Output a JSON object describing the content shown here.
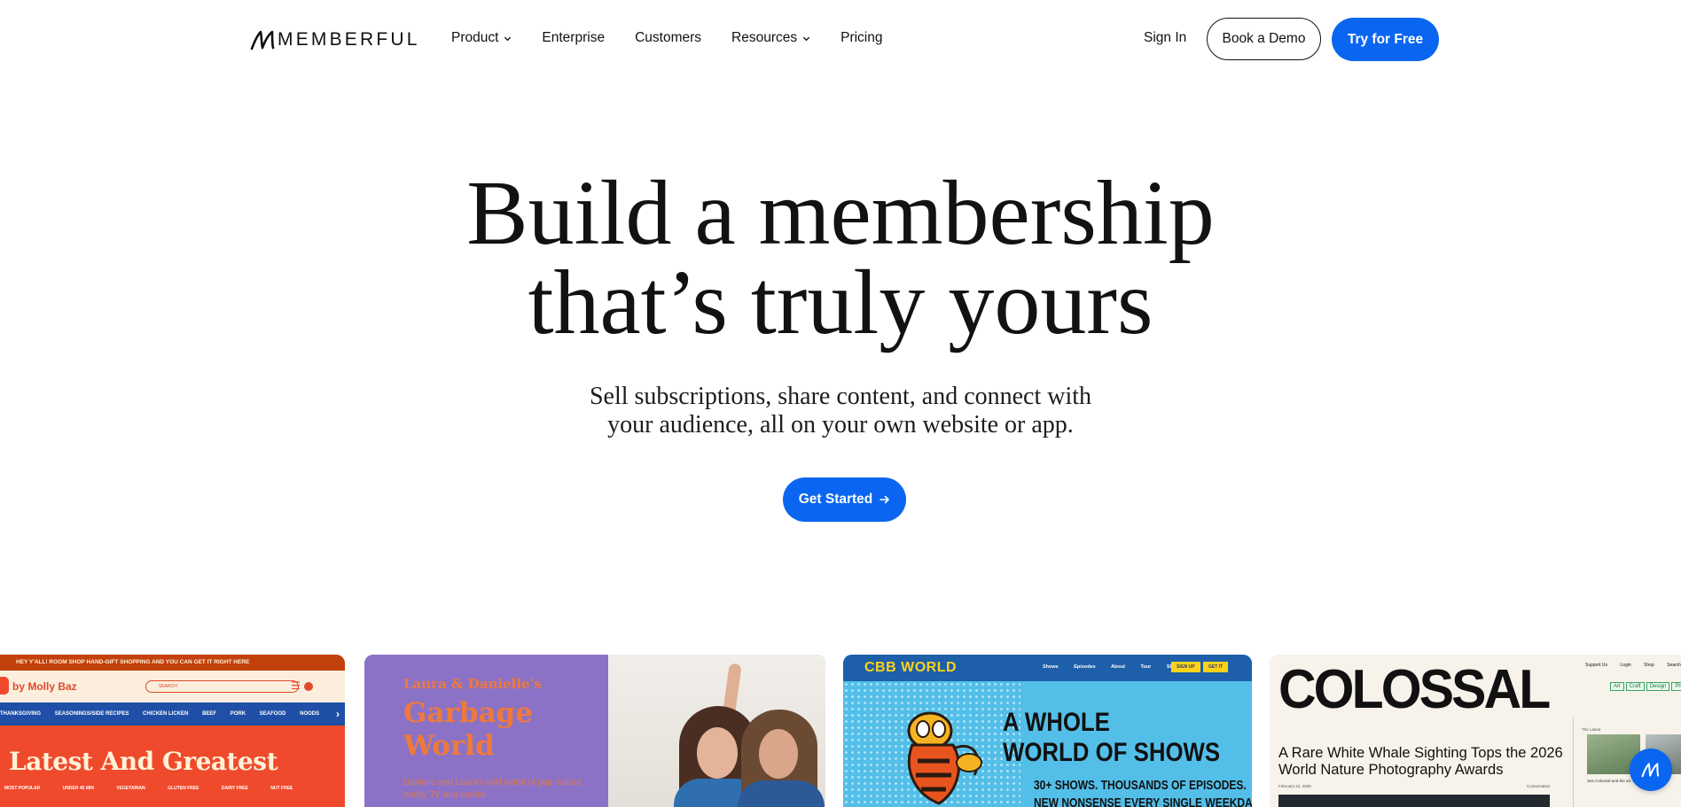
{
  "header": {
    "logo_text": "MEMBERFUL",
    "nav": [
      {
        "label": "Product",
        "has_dropdown": true
      },
      {
        "label": "Enterprise",
        "has_dropdown": false
      },
      {
        "label": "Customers",
        "has_dropdown": false
      },
      {
        "label": "Resources",
        "has_dropdown": true
      },
      {
        "label": "Pricing",
        "has_dropdown": false
      }
    ],
    "sign_in": "Sign In",
    "book_demo": "Book a Demo",
    "try_free": "Try for Free"
  },
  "hero": {
    "title_line1": "Build a membership",
    "title_line2": "that’s truly yours",
    "subtitle_line1": "Sell subscriptions, share content, and connect with",
    "subtitle_line2": "your audience, all on your own website or app.",
    "cta": "Get Started"
  },
  "showcase": {
    "card1": {
      "topbar": "HEY Y'ALL! ROOM SHOP HAND-GIFT SHOPPING AND YOU CAN GET IT RIGHT HERE",
      "byline": "by Molly Baz",
      "search_placeholder": "SEARCH",
      "strip": [
        "THANKSGIVING",
        "SEASONINGS/SIDE RECIPES",
        "CHICKEN LICKEN",
        "BEEF",
        "PORK",
        "SEAFOOD",
        "NOODS"
      ],
      "headline": "Latest And Greatest",
      "categories": [
        "MOST POPULAR",
        "UNDER 45 MIN",
        "VEGETARIAN",
        "GLUTEN FREE",
        "DAIRY FREE",
        "NUT FREE"
      ]
    },
    "card2": {
      "kicker": "Laura & Danielle's",
      "title_line1": "Garbage",
      "title_line2": "World",
      "desc": "Danielle and Laura's wild world of pop culture, reality TV and stories"
    },
    "card3": {
      "brand": "CBB WORLD",
      "links": [
        "Shows",
        "Episodes",
        "About",
        "Tour",
        "Shop"
      ],
      "pill1": "SIGN UP",
      "pill2": "GET IT",
      "headline_line1": "A WHOLE",
      "headline_line2": "WORLD OF SHOWS",
      "sub_line1": "30+ SHOWS. THOUSANDS OF EPISODES.",
      "sub_line2": "NEW NONSENSE EVERY SINGLE WEEKDAY"
    },
    "card4": {
      "logo": "COLOSSAL",
      "toplinks": [
        "Support Us",
        "Login",
        "Shop",
        "Search"
      ],
      "tags": [
        "Art",
        "Craft",
        "Design",
        "Photo"
      ],
      "article": "A Rare White Whale Sighting Tops the 2026 World Nature Photography Awards",
      "date": "February 22, 2026",
      "edit": "Conservation",
      "side_label": "The Latest",
      "side_caption": "See Colossal and the art..."
    }
  },
  "colors": {
    "accent": "#0a66f0",
    "text": "#111111"
  }
}
